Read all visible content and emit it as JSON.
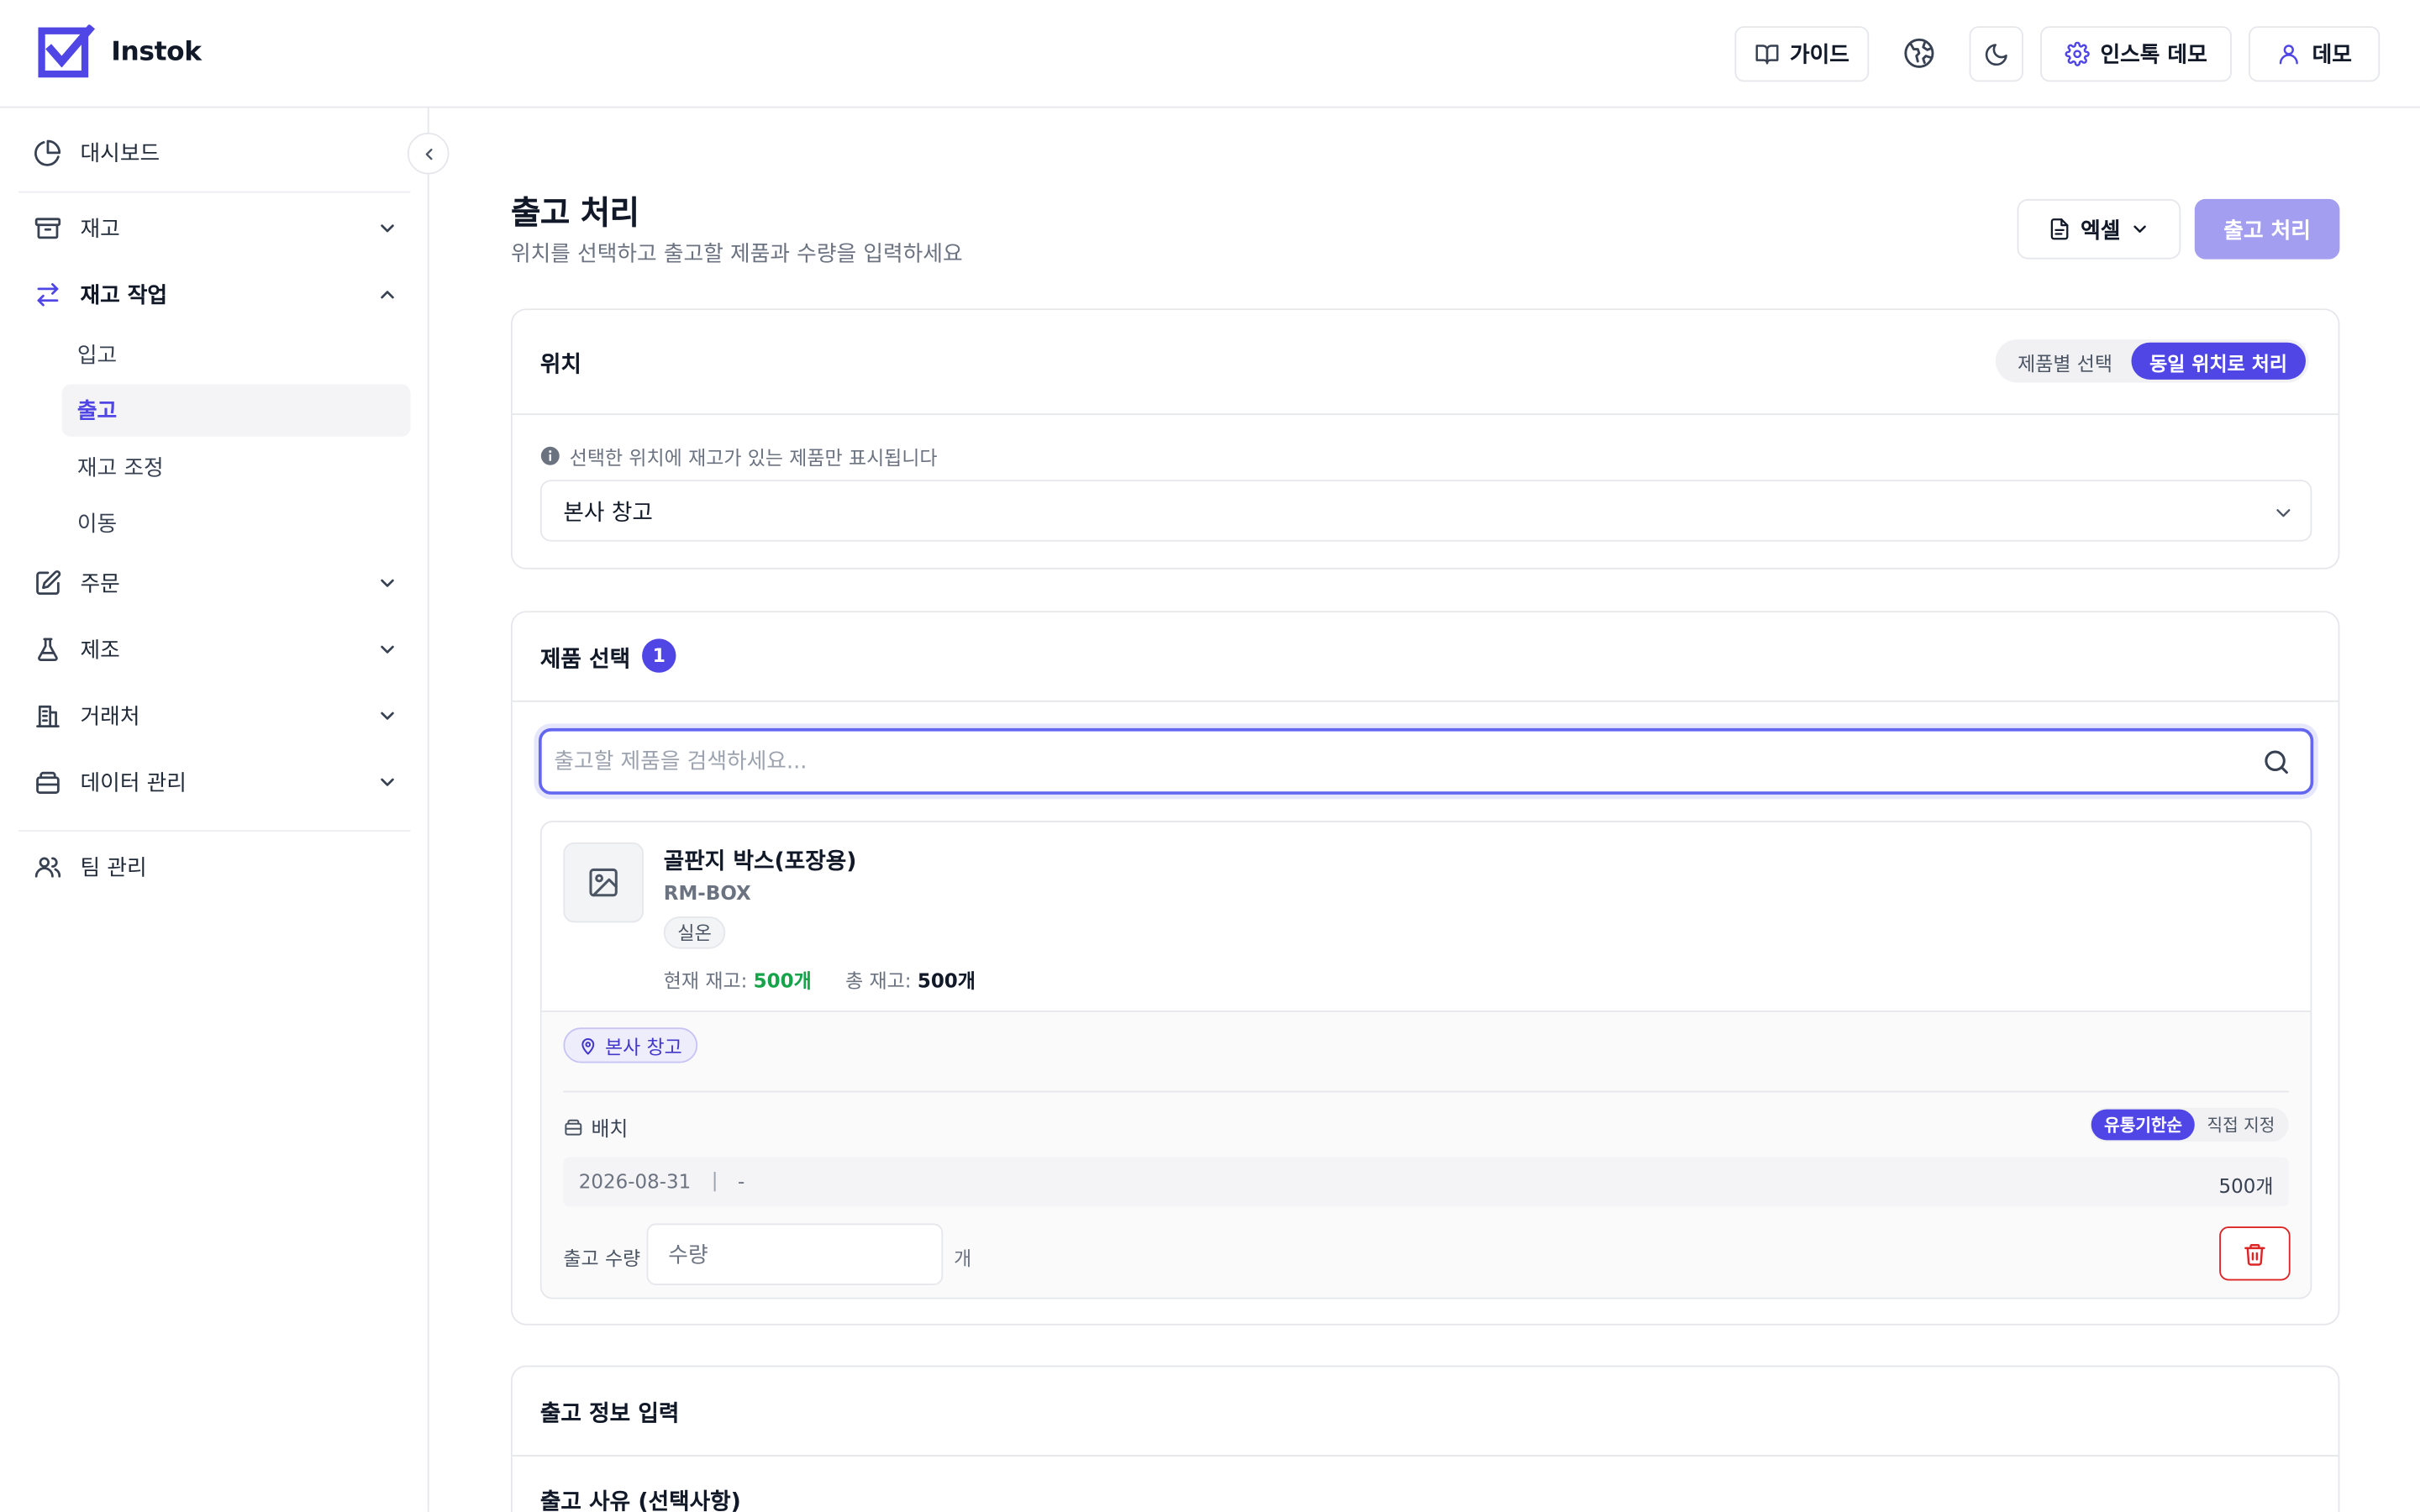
{
  "app": {
    "name": "Instok"
  },
  "header": {
    "guide_label": "가이드",
    "workspace_label": "인스톡 데모",
    "user_label": "데모"
  },
  "sidebar": {
    "items": [
      {
        "label": "대시보드",
        "icon": "pie-chart-icon"
      },
      {
        "label": "재고",
        "icon": "archive-icon"
      },
      {
        "label": "재고 작업",
        "icon": "arrows-swap-icon"
      },
      {
        "label": "주문",
        "icon": "edit-icon"
      },
      {
        "label": "제조",
        "icon": "flask-icon"
      },
      {
        "label": "거래처",
        "icon": "building-icon"
      },
      {
        "label": "데이터 관리",
        "icon": "database-icon"
      },
      {
        "label": "팀 관리",
        "icon": "users-icon"
      }
    ],
    "sub_items": [
      "입고",
      "출고",
      "재고 조정",
      "이동"
    ],
    "active_sub": "출고"
  },
  "page": {
    "title": "출고 처리",
    "subtitle": "위치를 선택하고 출고할 제품과 수량을 입력하세요",
    "excel_label": "엑셀",
    "submit_label": "출고 처리"
  },
  "location_card": {
    "title": "위치",
    "toggle": {
      "option1": "제품별 선택",
      "option2": "동일 위치로 처리",
      "selected": "동일 위치로 처리"
    },
    "info": "선택한 위치에 재고가 있는 제품만 표시됩니다",
    "selected_location": "본사 창고"
  },
  "product_card": {
    "title": "제품 선택",
    "count": "1",
    "search_placeholder": "출고할 제품을 검색하세요...",
    "product": {
      "name": "골판지 박스(포장용)",
      "code": "RM-BOX",
      "tag": "실온",
      "current_stock_label": "현재 재고:",
      "current_stock": "500개",
      "total_stock_label": "총 재고:",
      "total_stock": "500개",
      "location": "본사 창고",
      "batch_label": "배치",
      "batch_toggle": {
        "option1": "유통기한순",
        "option2": "직접 지정",
        "selected": "유통기한순"
      },
      "batch": {
        "expiry": "2026-08-31",
        "separator": "|",
        "lot": "-",
        "qty": "500개"
      },
      "qty_label": "출고 수량",
      "qty_placeholder": "수량",
      "qty_unit": "개"
    }
  },
  "info_card": {
    "title": "출고 정보 입력",
    "reason_label": "출고 사유 (선택사항)"
  },
  "colors": {
    "accent": "#4f46e5",
    "accent_disabled": "#a39ef0",
    "success": "#16a34a",
    "danger": "#dc2626",
    "border": "#e5e7eb"
  }
}
